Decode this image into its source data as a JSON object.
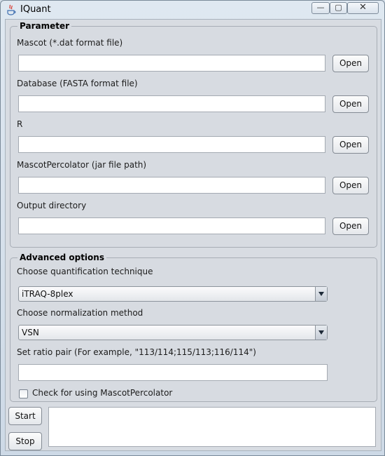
{
  "window": {
    "title": "IQuant",
    "min_glyph": "—",
    "max_glyph": "▢",
    "close_glyph": "✕"
  },
  "parameter": {
    "title": "Parameter",
    "mascot_label": "Mascot (*.dat format file)",
    "mascot_value": "",
    "database_label": "Database (FASTA format file)",
    "database_value": "",
    "r_label": "R",
    "r_value": "",
    "percolator_label": "MascotPercolator (jar file path)",
    "percolator_value": "",
    "output_label": "Output directory",
    "output_value": "",
    "open_label": "Open"
  },
  "advanced": {
    "title": "Advanced options",
    "quant_label": "Choose quantification technique",
    "quant_value": "iTRAQ-8plex",
    "norm_label": "Choose normalization method",
    "norm_value": "VSN",
    "ratio_label": "Set ratio pair (For example, \"113/114;115/113;116/114\")",
    "ratio_value": "",
    "check_label": "Check for using MascotPercolator",
    "check_checked": false
  },
  "actions": {
    "start_label": "Start",
    "stop_label": "Stop"
  }
}
